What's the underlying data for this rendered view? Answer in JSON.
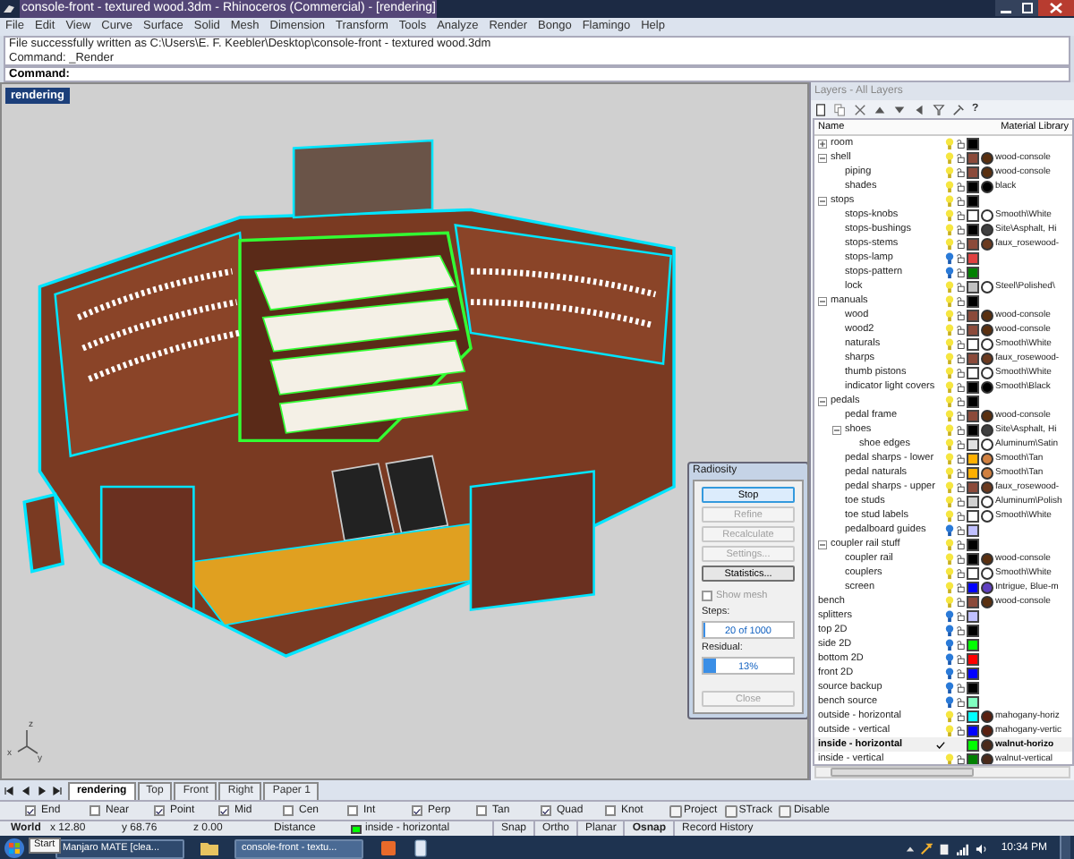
{
  "window": {
    "title": "console-front - textured wood.3dm - Rhinoceros (Commercial) - [rendering]"
  },
  "menu": [
    "File",
    "Edit",
    "View",
    "Curve",
    "Surface",
    "Solid",
    "Mesh",
    "Dimension",
    "Transform",
    "Tools",
    "Analyze",
    "Render",
    "Bongo",
    "Flamingo",
    "Help"
  ],
  "command_history": [
    "File successfully written as C:\\Users\\E. F. Keebler\\Desktop\\console-front - textured wood.3dm",
    "Command: _Render"
  ],
  "command_prompt": "Command:",
  "viewport": {
    "title": "rendering",
    "axes": [
      "z",
      "x",
      "y"
    ]
  },
  "radiosity": {
    "title": "Radiosity",
    "buttons": [
      {
        "label": "Stop",
        "disabled": false,
        "default": true
      },
      {
        "label": "Refine",
        "disabled": true,
        "default": false
      },
      {
        "label": "Recalculate",
        "disabled": true,
        "default": false
      },
      {
        "label": "Settings...",
        "disabled": true,
        "default": false
      },
      {
        "label": "Statistics...",
        "disabled": false,
        "default": false
      }
    ],
    "show_mesh": {
      "label": "Show mesh",
      "checked": false
    },
    "steps": {
      "label": "Steps:",
      "level": 0.02,
      "reading": "20 of 1000"
    },
    "residual": {
      "label": "Residual:",
      "level": 0.13,
      "reading": "13%"
    },
    "close": {
      "label": "Close",
      "disabled": true
    }
  },
  "layers": {
    "title": "Layers - All Layers",
    "help": "?",
    "columns": [
      "Name",
      "Material Library"
    ],
    "items": [
      {
        "name": "room",
        "visible": true,
        "color": "#000000",
        "expanded": false,
        "current": false
      },
      {
        "name": "shell",
        "visible": true,
        "color": "#8b4a3a",
        "material": {
          "name": "wood-console",
          "color": "#5a3010"
        },
        "expanded": true,
        "current": false,
        "children": [
          {
            "name": "piping",
            "visible": true,
            "color": "#8b4a3a",
            "material": {
              "name": "wood-console",
              "color": "#5a3010"
            },
            "current": false
          },
          {
            "name": "shades",
            "visible": true,
            "color": "#000000",
            "material": {
              "name": "black",
              "color": "#000000"
            },
            "current": false
          }
        ]
      },
      {
        "name": "stops",
        "visible": true,
        "color": "#000000",
        "expanded": true,
        "current": false,
        "children": [
          {
            "name": "stops-knobs",
            "visible": true,
            "color": "#ffffff",
            "material": {
              "name": "Smooth\\White",
              "color": "#ffffff"
            },
            "current": false
          },
          {
            "name": "stops-bushings",
            "visible": true,
            "color": "#000000",
            "material": {
              "name": "Site\\Asphalt, Hi",
              "color": "#404040"
            },
            "current": false
          },
          {
            "name": "stops-stems",
            "visible": true,
            "color": "#8b4a3a",
            "material": {
              "name": "faux_rosewood-",
              "color": "#6b3a1f"
            },
            "current": false
          },
          {
            "name": "stops-lamp",
            "visible": false,
            "color": "#e04040",
            "current": false
          },
          {
            "name": "stops-pattern",
            "visible": false,
            "color": "#008000",
            "current": false
          },
          {
            "name": "lock",
            "visible": true,
            "color": "#c0c0c0",
            "material": {
              "name": "Steel\\Polished\\",
              "color": "#ffffff"
            },
            "current": false
          }
        ]
      },
      {
        "name": "manuals",
        "visible": true,
        "color": "#000000",
        "expanded": true,
        "current": false,
        "children": [
          {
            "name": "wood",
            "visible": true,
            "color": "#8b4a3a",
            "material": {
              "name": "wood-console",
              "color": "#5a3010"
            },
            "current": false
          },
          {
            "name": "wood2",
            "visible": true,
            "color": "#8b4a3a",
            "material": {
              "name": "wood-console",
              "color": "#5a3010"
            },
            "current": false
          },
          {
            "name": "naturals",
            "visible": true,
            "color": "#ffffff",
            "material": {
              "name": "Smooth\\White",
              "color": "#ffffff"
            },
            "current": false
          },
          {
            "name": "sharps",
            "visible": true,
            "color": "#8b4a3a",
            "material": {
              "name": "faux_rosewood-",
              "color": "#6b3a1f"
            },
            "current": false
          },
          {
            "name": "thumb pistons",
            "visible": true,
            "color": "#ffffff",
            "material": {
              "name": "Smooth\\White",
              "color": "#ffffff"
            },
            "current": false
          },
          {
            "name": "indicator light covers",
            "visible": true,
            "color": "#000000",
            "material": {
              "name": "Smooth\\Black",
              "color": "#000000"
            },
            "current": false
          }
        ]
      },
      {
        "name": "pedals",
        "visible": true,
        "color": "#000000",
        "expanded": true,
        "current": false,
        "children": [
          {
            "name": "pedal frame",
            "visible": true,
            "color": "#8b4a3a",
            "material": {
              "name": "wood-console",
              "color": "#5a3010"
            },
            "current": false
          },
          {
            "name": "shoes",
            "visible": true,
            "color": "#000000",
            "material": {
              "name": "Site\\Asphalt, Hi",
              "color": "#404040"
            },
            "expanded": true,
            "current": false,
            "children": [
              {
                "name": "shoe edges",
                "visible": true,
                "color": "#e0e0e0",
                "material": {
                  "name": "Aluminum\\Satin",
                  "color": "#ffffff"
                },
                "current": false
              }
            ]
          },
          {
            "name": "pedal sharps - lower",
            "visible": true,
            "color": "#ffb000",
            "material": {
              "name": "Smooth\\Tan",
              "color": "#d08040"
            },
            "current": false
          },
          {
            "name": "pedal naturals",
            "visible": true,
            "color": "#ffb000",
            "material": {
              "name": "Smooth\\Tan",
              "color": "#d08040"
            },
            "current": false
          },
          {
            "name": "pedal sharps - upper",
            "visible": true,
            "color": "#8b4a3a",
            "material": {
              "name": "faux_rosewood-",
              "color": "#6b3a1f"
            },
            "current": false
          },
          {
            "name": "toe studs",
            "visible": true,
            "color": "#d0d0d0",
            "material": {
              "name": "Aluminum\\Polish",
              "color": "#ffffff"
            },
            "current": false
          },
          {
            "name": "toe stud labels",
            "visible": true,
            "color": "#ffffff",
            "material": {
              "name": "Smooth\\White",
              "color": "#ffffff"
            },
            "current": false
          },
          {
            "name": "pedalboard guides",
            "visible": false,
            "color": "#c0c0ff",
            "current": false
          }
        ]
      },
      {
        "name": "coupler rail stuff",
        "visible": true,
        "color": "#000000",
        "expanded": true,
        "current": false,
        "children": [
          {
            "name": "coupler rail",
            "visible": true,
            "color": "#000000",
            "material": {
              "name": "wood-console",
              "color": "#5a3010"
            },
            "current": false
          },
          {
            "name": "couplers",
            "visible": true,
            "color": "#ffffff",
            "material": {
              "name": "Smooth\\White",
              "color": "#ffffff"
            },
            "current": false
          },
          {
            "name": "screen",
            "visible": true,
            "color": "#0000ff",
            "material": {
              "name": "Intrigue, Blue-m",
              "color": "#6040c0"
            },
            "current": false
          }
        ]
      },
      {
        "name": "bench",
        "visible": true,
        "color": "#8b4a3a",
        "material": {
          "name": "wood-console",
          "color": "#5a3010"
        },
        "current": false
      },
      {
        "name": "splitters",
        "visible": false,
        "color": "#c0c0ff",
        "current": false
      },
      {
        "name": "top 2D",
        "visible": false,
        "color": "#000000",
        "current": false
      },
      {
        "name": "side 2D",
        "visible": false,
        "color": "#00ff00",
        "current": false
      },
      {
        "name": "bottom 2D",
        "visible": false,
        "color": "#ff0000",
        "current": false
      },
      {
        "name": "front 2D",
        "visible": false,
        "color": "#0000ff",
        "current": false
      },
      {
        "name": "source backup",
        "visible": false,
        "color": "#000000",
        "current": false
      },
      {
        "name": "bench source",
        "visible": false,
        "color": "#80ffc0",
        "current": false
      },
      {
        "name": "outside - horizontal",
        "visible": true,
        "color": "#00ffff",
        "material": {
          "name": "mahogany-horiz",
          "color": "#5a2010"
        },
        "current": false
      },
      {
        "name": "outside - vertical",
        "visible": true,
        "color": "#0000ff",
        "material": {
          "name": "mahogany-vertic",
          "color": "#5a2010"
        },
        "current": false
      },
      {
        "name": "inside - horizontal",
        "color": "#00ff00",
        "material": {
          "name": "walnut-horizo",
          "color": "#4a2a1a"
        },
        "current": true
      },
      {
        "name": "inside - vertical",
        "visible": true,
        "color": "#008000",
        "material": {
          "name": "walnut-vertical",
          "color": "#4a2a1a"
        },
        "current": false
      }
    ]
  },
  "view_tabs": [
    {
      "label": "rendering",
      "selected": true
    },
    {
      "label": "Top",
      "selected": false
    },
    {
      "label": "Front",
      "selected": false
    },
    {
      "label": "Right",
      "selected": false
    },
    {
      "label": "Paper 1",
      "selected": false
    }
  ],
  "osnap": [
    {
      "kind": "check",
      "label": "End",
      "checked": true
    },
    {
      "kind": "check",
      "label": "Near",
      "checked": false
    },
    {
      "kind": "check",
      "label": "Point",
      "checked": true
    },
    {
      "kind": "check",
      "label": "Mid",
      "checked": true
    },
    {
      "kind": "check",
      "label": "Cen",
      "checked": false
    },
    {
      "kind": "check",
      "label": "Int",
      "checked": false
    },
    {
      "kind": "check",
      "label": "Perp",
      "checked": true
    },
    {
      "kind": "check",
      "label": "Tan",
      "checked": false
    },
    {
      "kind": "check",
      "label": "Quad",
      "checked": true
    },
    {
      "kind": "check",
      "label": "Knot",
      "checked": false
    },
    {
      "kind": "toggle",
      "label": "Project",
      "checked": false
    },
    {
      "kind": "toggle",
      "label": "STrack",
      "checked": false
    },
    {
      "kind": "toggle",
      "label": "Disable",
      "checked": false
    }
  ],
  "status_bar": {
    "cplane": "World",
    "x": "x 12.80",
    "y": "y 68.76",
    "z": "z 0.00",
    "distance": "Distance",
    "layer": {
      "name": "inside - horizontal",
      "color": "#00ff00"
    },
    "panes": [
      {
        "label": "Snap",
        "on": false
      },
      {
        "label": "Ortho",
        "on": false
      },
      {
        "label": "Planar",
        "on": false
      },
      {
        "label": "Osnap",
        "on": true
      },
      {
        "label": "Record History",
        "on": false
      }
    ]
  },
  "taskbar": {
    "tooltip": "Start",
    "windows": [
      {
        "label": "Manjaro MATE [clea...",
        "selected": false
      },
      {
        "label": "console-front - textu...",
        "selected": true
      }
    ],
    "clock": "10:34 PM"
  }
}
